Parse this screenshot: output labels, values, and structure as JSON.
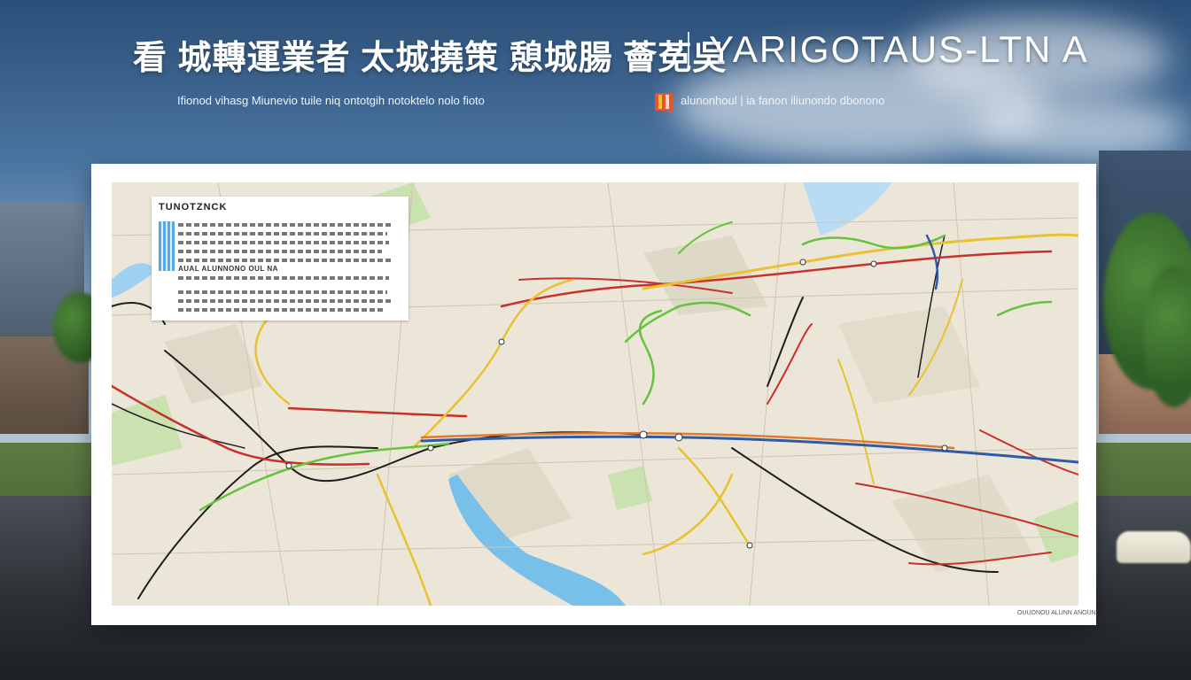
{
  "header": {
    "title_cjk": "看 城轉運業者 太城撓策 憩城腸 薈莬吳",
    "title_latin": "YARIGOTAUS-LTN A",
    "subtitle_left": "Ifionod vihasg Miunevio tuile niq ontotgih notoktelo nolo fioto",
    "subtitle_right": "alunonhoul | ia fanon iliunondo dbonono"
  },
  "map": {
    "legend_title": "TUNOTZNCK",
    "legend_subheading": "AUAL ALUNNONO OUL NA",
    "footer_note": "OUUONOU ALUNN ANOUN",
    "colors": {
      "red_line": "#c8312a",
      "yellow_line": "#e8c230",
      "green_line": "#62c43c",
      "black_line": "#1e1e1e",
      "blue_line": "#2e5aa8",
      "orange_line": "#e07a2a",
      "water": "#78bfe9"
    }
  }
}
